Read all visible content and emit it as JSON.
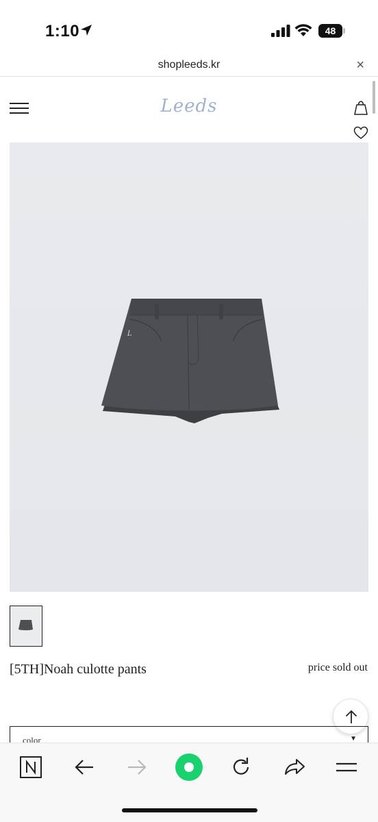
{
  "status_bar": {
    "time": "1:10",
    "battery": "48"
  },
  "browser": {
    "url": "shopleeds.kr",
    "close": "×"
  },
  "site": {
    "logo": "Leeds"
  },
  "product": {
    "name": "[5TH]Noah culotte pants",
    "price": "price sold out",
    "image_subject": "gray mini culotte skirt"
  },
  "options": {
    "color_label": "color",
    "caret": "▼"
  },
  "colors": {
    "logo": "#9fb2cf",
    "image_bg": "#e7e9ec",
    "garment": "#4d4f53",
    "active_green": "#19d26e"
  },
  "icons": {
    "menu": "hamburger-icon",
    "bag": "shopping-bag-icon",
    "wishlist": "heart-icon",
    "scroll_top": "arrow-up-icon",
    "browser_home": "naver-n-icon",
    "back": "arrow-left-icon",
    "forward": "arrow-right-icon",
    "green_dot": "green-dot-icon",
    "reload": "reload-icon",
    "share": "share-icon",
    "tabs_menu": "menu-lines-icon"
  }
}
